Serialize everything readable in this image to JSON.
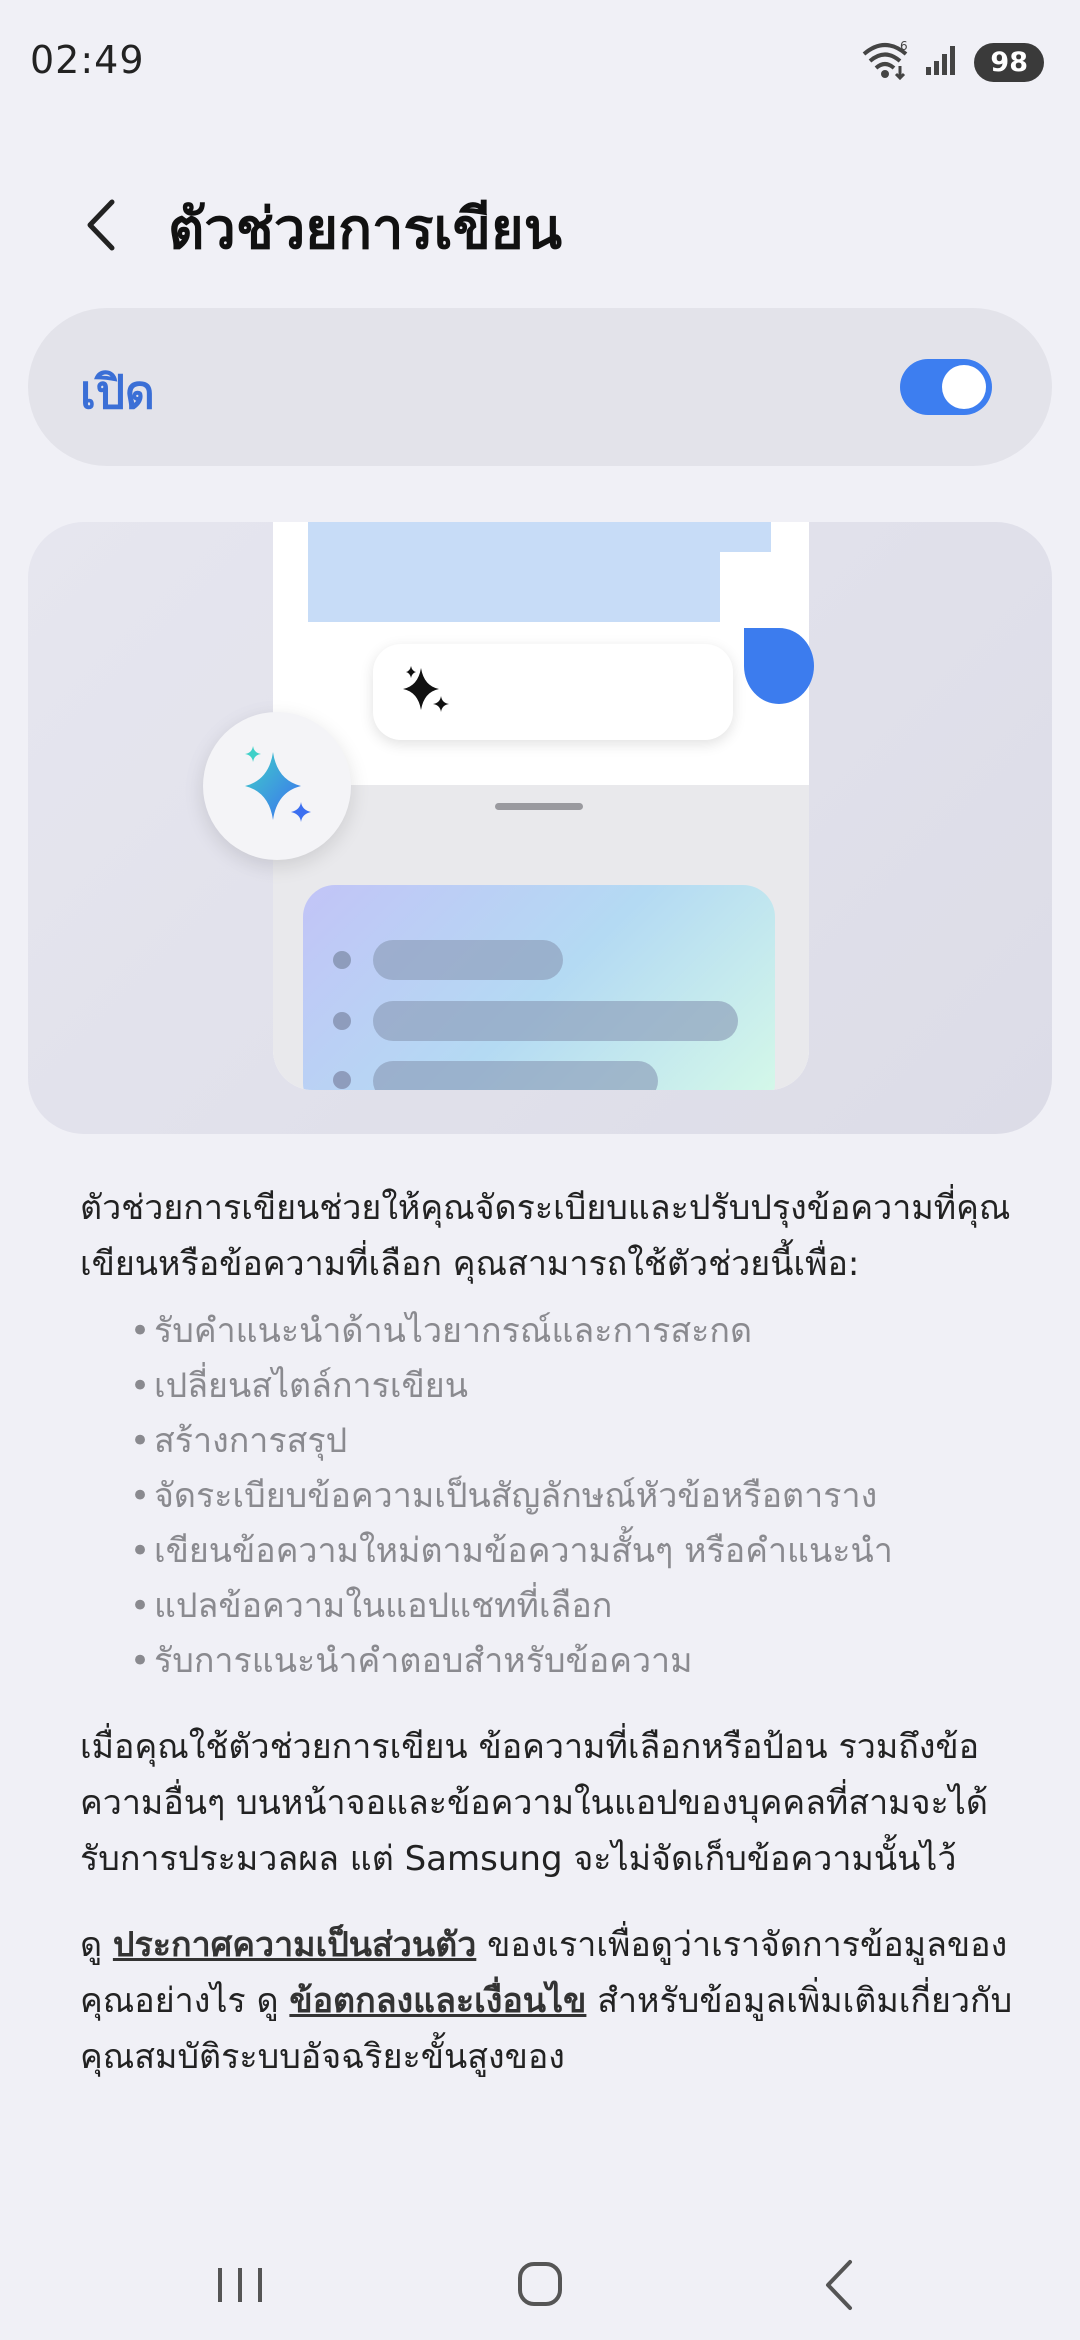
{
  "status": {
    "time": "02:49",
    "battery": "98",
    "icons": [
      "wifi-icon",
      "signal-icon",
      "battery-icon"
    ]
  },
  "header": {
    "title": "ตัวช่วยการเขียน",
    "back_icon": "chevron-left-icon"
  },
  "toggle": {
    "label": "เปิด",
    "state": "on",
    "accent": "#3d7ef0"
  },
  "description": {
    "intro": "ตัวช่วยการเขียนช่วยให้คุณจัดระเบียบและปรับปรุงข้อความที่คุณเขียนหรือข้อความที่เลือก คุณสามารถใช้ตัวช่วยนี้เพื่อ:",
    "features": [
      "รับคำแนะนำด้านไวยากรณ์และการสะกด",
      "เปลี่ยนสไตล์การเขียน",
      "สร้างการสรุป",
      "จัดระเบียบข้อความเป็นสัญลักษณ์หัวข้อหรือตาราง",
      "เขียนข้อความใหม่ตามข้อความสั้นๆ หรือคำแนะนำ",
      "แปลข้อความในแอปแชทที่เลือก",
      "รับการแนะนำคำตอบสำหรับข้อความ"
    ],
    "privacy": "เมื่อคุณใช้ตัวช่วยการเขียน ข้อความที่เลือกหรือป้อน รวมถึงข้อความอื่นๆ บนหน้าจอและข้อความในแอปของบุคคลที่สามจะได้รับการประมวลผล แต่ Samsung จะไม่จัดเก็บข้อความนั้นไว้",
    "links": {
      "prefix": "ดู ",
      "privacy_link": "ประกาศความเป็นส่วนตัว",
      "middle": " ของเราเพื่อดูว่าเราจัดการข้อมูลของคุณอย่างไร ดู ",
      "terms_link": "ข้อตกลงและเงื่อนไข",
      "suffix": " สำหรับข้อมูลเพิ่มเติมเกี่ยวกับคุณสมบัติระบบอัจฉริยะขั้นสูงของ"
    }
  },
  "nav": {
    "recents_icon": "recents-icon",
    "home_icon": "home-icon",
    "back_icon": "back-icon"
  }
}
